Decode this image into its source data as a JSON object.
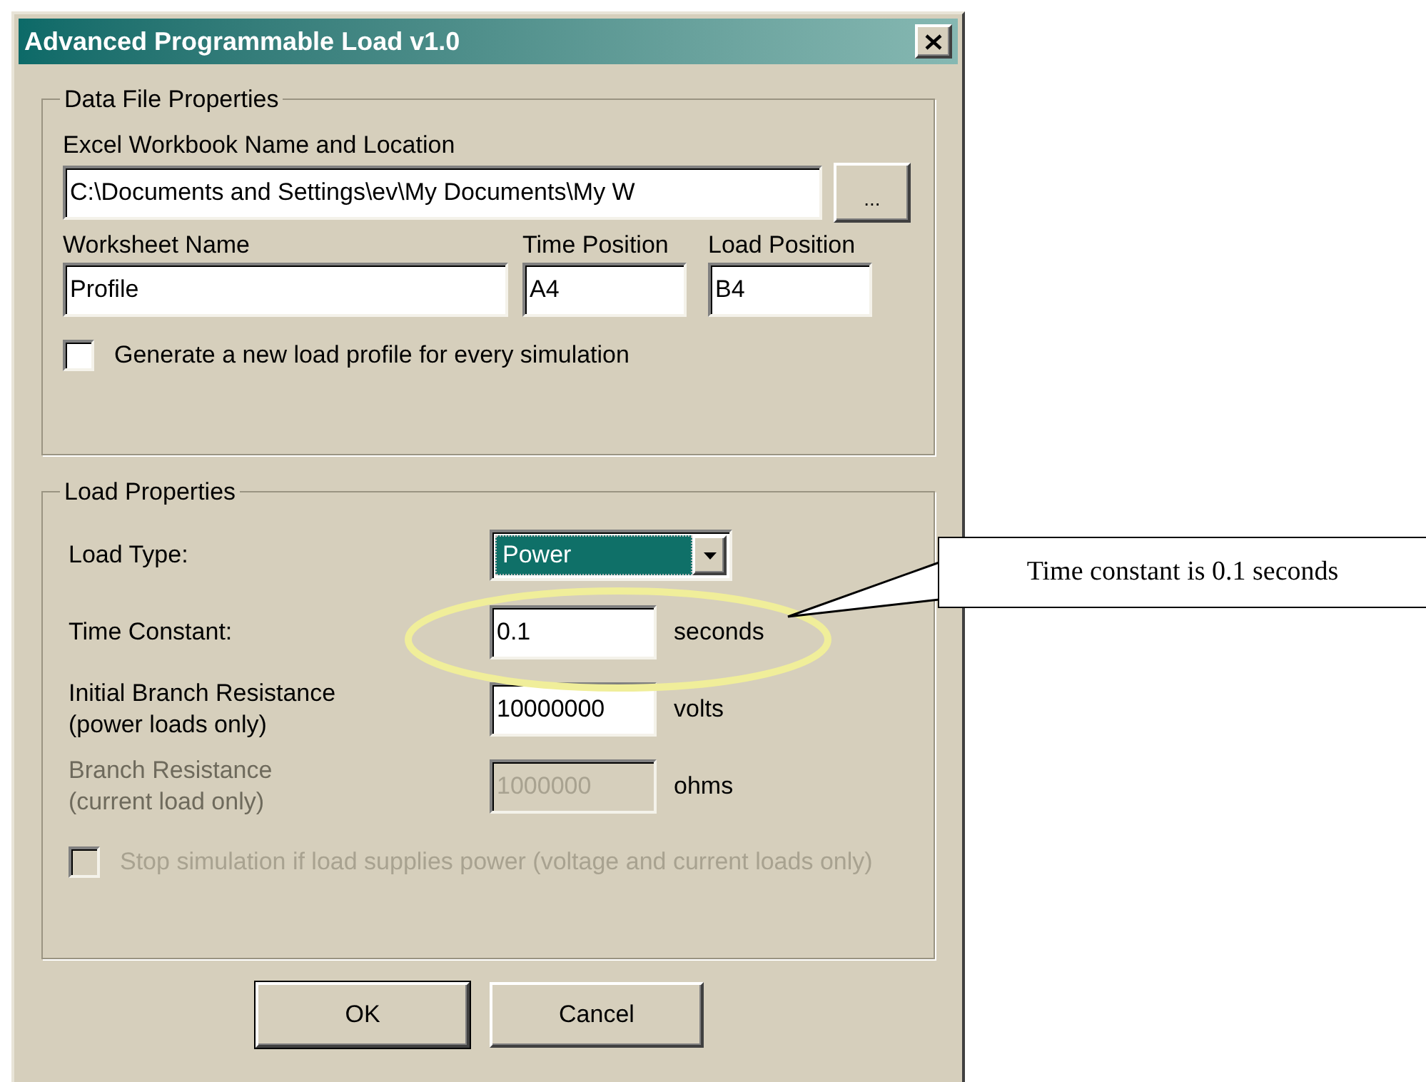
{
  "window": {
    "title": "Advanced Programmable Load v1.0"
  },
  "data_file_properties": {
    "title": "Data File Properties",
    "workbook_label": "Excel Workbook Name and Location",
    "workbook_value": "C:\\Documents and Settings\\ev\\My Documents\\My W",
    "browse_button": "...",
    "worksheet_label": "Worksheet Name",
    "worksheet_value": "Profile",
    "time_position_label": "Time Position",
    "time_position_value": "A4",
    "load_position_label": "Load Position",
    "load_position_value": "B4",
    "generate_checkbox": {
      "label": "Generate a new load profile for every simulation",
      "checked": false,
      "disabled": false
    }
  },
  "load_properties": {
    "title": "Load Properties",
    "rows": [
      {
        "kind": "dropdown",
        "label": [
          "Load Type:"
        ],
        "value": "Power"
      },
      {
        "kind": "field",
        "label": [
          "Time Constant:"
        ],
        "value": "0.1",
        "unit": "seconds",
        "disabled": false
      },
      {
        "kind": "field",
        "label": [
          "Initial Branch Resistance",
          "(power loads only)"
        ],
        "value": "10000000",
        "unit": "volts",
        "disabled": false
      },
      {
        "kind": "field",
        "label": [
          "Branch Resistance",
          "(current load only)"
        ],
        "value": "1000000",
        "unit": "ohms",
        "disabled": true
      }
    ],
    "stop_checkbox": {
      "label": "Stop simulation if load supplies power (voltage and current loads only)",
      "checked": false,
      "disabled": true
    }
  },
  "buttons": [
    {
      "label": "OK",
      "default": true
    },
    {
      "label": "Cancel",
      "default": false
    }
  ],
  "callout": {
    "text": "Time constant is 0.1 seconds"
  }
}
